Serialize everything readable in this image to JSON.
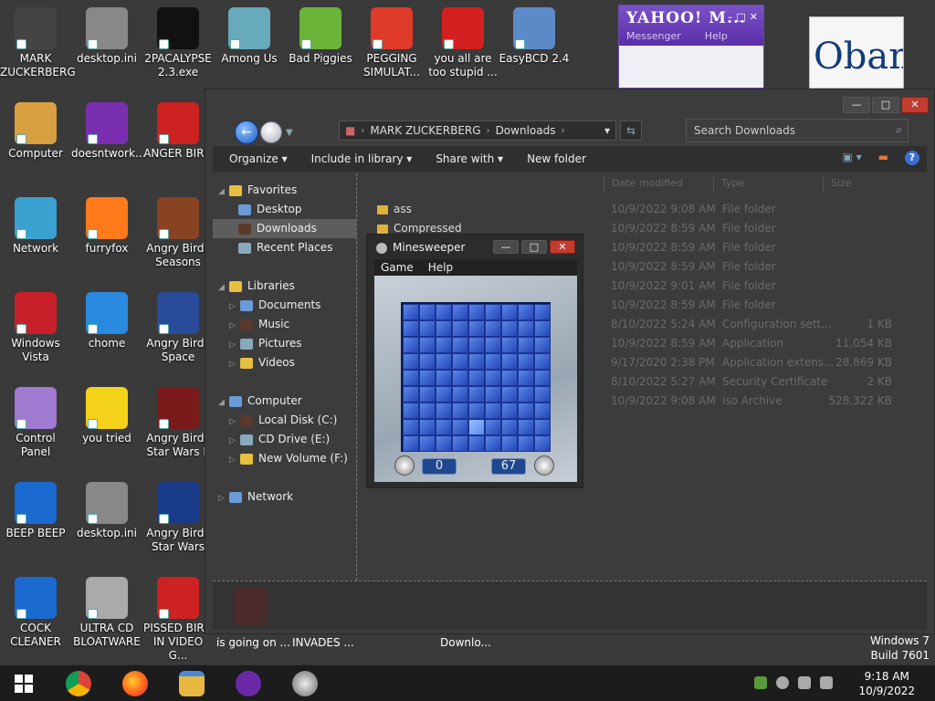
{
  "desktop_icons": [
    {
      "label": "MARK ZUCKERBERG",
      "icon": "user-folder-icon",
      "color": "#444"
    },
    {
      "label": "desktop.ini",
      "icon": "config-file-icon",
      "color": "#888"
    },
    {
      "label": "2PACALYPSE 2.3.exe",
      "icon": "console-app-icon",
      "color": "#111"
    },
    {
      "label": "Among Us",
      "icon": "notepad-icon",
      "color": "#6ab"
    },
    {
      "label": "Bad Piggies",
      "icon": "green-pig-icon",
      "color": "#6cb33a"
    },
    {
      "label": "PEGGING SIMULAT...",
      "icon": "letter-p-icon",
      "color": "#e03a2a"
    },
    {
      "label": "you all are too stupid ...",
      "icon": "dev-cpp-icon",
      "color": "#d42020"
    },
    {
      "label": "EasyBCD 2.4",
      "icon": "computer-disk-icon",
      "color": "#5b8ac8"
    },
    {
      "label": "Computer",
      "icon": "computer-icon",
      "color": "#d8a040"
    },
    {
      "label": "doesntwork...",
      "icon": "yahoo-icon",
      "color": "#7a2fb0"
    },
    {
      "label": "ANGER BIRD",
      "icon": "angry-bird-icon",
      "color": "#cc2222"
    },
    {
      "label": "Network",
      "icon": "network-globe-icon",
      "color": "#3aa0d0"
    },
    {
      "label": "furryfox",
      "icon": "firefox-icon",
      "color": "#ff7a1a"
    },
    {
      "label": "Angry Birds Seasons",
      "icon": "angry-birds-seasons-icon",
      "color": "#884422"
    },
    {
      "label": "Windows Vista",
      "icon": "recycle-bin-icon",
      "color": "#c8202a"
    },
    {
      "label": "chome",
      "icon": "chrome-icon",
      "color": "#2a8ae0"
    },
    {
      "label": "Angry Birds Space",
      "icon": "angry-birds-space-icon",
      "color": "#2a4a9a"
    },
    {
      "label": "Control Panel",
      "icon": "control-panel-icon",
      "color": "#a07ad0"
    },
    {
      "label": "you tried",
      "icon": "star-icon",
      "color": "#f5d21a"
    },
    {
      "label": "Angry Birds Star Wars II",
      "icon": "angry-birds-starwars2-icon",
      "color": "#7a1a1a"
    },
    {
      "label": "BEEP BEEP",
      "icon": "blue-book-icon",
      "color": "#1a6ad0"
    },
    {
      "label": "desktop.ini",
      "icon": "config-file-icon",
      "color": "#888"
    },
    {
      "label": "Angry Birds Star Wars",
      "icon": "angry-birds-starwars-icon",
      "color": "#1a3a8a"
    },
    {
      "label": "COCK CLEANER",
      "icon": "blue-book-icon",
      "color": "#1a6ad0"
    },
    {
      "label": "ULTRA CD BLOATWARE",
      "icon": "cd-disc-icon",
      "color": "#aaa"
    },
    {
      "label": "PISSED BIRD IN VIDEO G...",
      "icon": "angry-bird-icon",
      "color": "#cc2222"
    }
  ],
  "yahoo": {
    "logo": "YAHOO! M...",
    "menu": [
      "Messenger",
      "Help"
    ]
  },
  "obama": {
    "text": "Obam"
  },
  "explorer": {
    "address": [
      "MARK ZUCKERBERG",
      "Downloads"
    ],
    "search_placeholder": "Search Downloads",
    "toolbar": [
      "Organize",
      "Include in library",
      "Share with",
      "New folder"
    ],
    "columns": [
      "Date modified",
      "Type",
      "Size"
    ],
    "nav": [
      {
        "label": "Favorites",
        "type": "header"
      },
      {
        "label": "Desktop",
        "type": "item"
      },
      {
        "label": "Downloads",
        "type": "item",
        "selected": true
      },
      {
        "label": "Recent Places",
        "type": "item"
      },
      {
        "label": "Libraries",
        "type": "header"
      },
      {
        "label": "Documents",
        "type": "sub"
      },
      {
        "label": "Music",
        "type": "sub"
      },
      {
        "label": "Pictures",
        "type": "sub"
      },
      {
        "label": "Videos",
        "type": "sub"
      },
      {
        "label": "Computer",
        "type": "header"
      },
      {
        "label": "Local Disk (C:)",
        "type": "sub"
      },
      {
        "label": "CD Drive (E:)",
        "type": "sub"
      },
      {
        "label": "New Volume (F:)",
        "type": "sub"
      },
      {
        "label": "Network",
        "type": "header"
      }
    ],
    "files": [
      {
        "name": "ass",
        "date": "10/9/2022 9:08 AM",
        "type": "File folder",
        "size": ""
      },
      {
        "name": "Compressed",
        "date": "10/9/2022 8:59 AM",
        "type": "File folder",
        "size": ""
      },
      {
        "name": "",
        "date": "10/9/2022 8:59 AM",
        "type": "File folder",
        "size": ""
      },
      {
        "name": "",
        "date": "10/9/2022 8:59 AM",
        "type": "File folder",
        "size": ""
      },
      {
        "name": "",
        "date": "10/9/2022 9:01 AM",
        "type": "File folder",
        "size": ""
      },
      {
        "name": "",
        "date": "10/9/2022 8:59 AM",
        "type": "File folder",
        "size": ""
      },
      {
        "name": "",
        "date": "8/10/2022 5:24 AM",
        "type": "Configuration sett...",
        "size": "1 KB"
      },
      {
        "name": "",
        "date": "10/9/2022 8:59 AM",
        "type": "Application",
        "size": "11,054 KB"
      },
      {
        "name": "",
        "date": "9/17/2020 2:38 PM",
        "type": "Application extens...",
        "size": "28,869 KB"
      },
      {
        "name": "",
        "date": "8/10/2022 5:27 AM",
        "type": "Security Certificate",
        "size": "2 KB"
      },
      {
        "name": "",
        "date": "10/9/2022 9:08 AM",
        "type": "iso Archive",
        "size": "528,322 KB"
      }
    ]
  },
  "minesweeper": {
    "title": "Minesweeper",
    "menu": [
      "Game",
      "Help"
    ],
    "time": "0",
    "mines": "67",
    "rows": 9,
    "cols": 9,
    "hover_cell": {
      "row": 7,
      "col": 4
    }
  },
  "taskbar_labels": [
    "is going on ...",
    "INVADES ...",
    "Downlo..."
  ],
  "windows_info": {
    "line1": "Windows 7",
    "line2": "Build 7601"
  },
  "clock": {
    "time": "9:18 AM",
    "date": "10/9/2022"
  }
}
